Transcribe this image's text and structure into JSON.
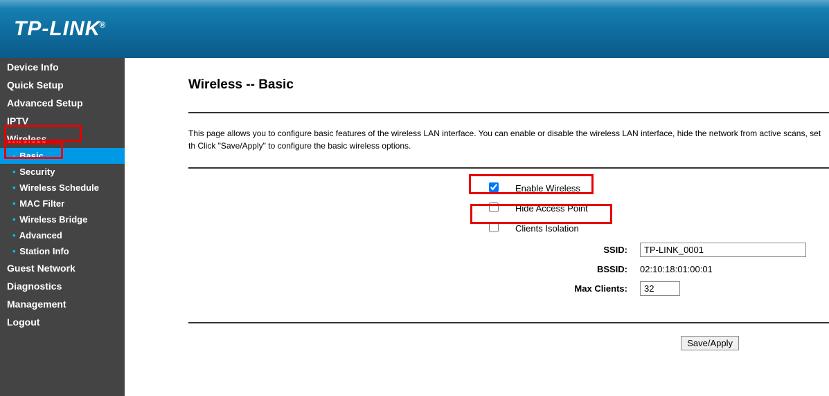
{
  "logo": "TP-LINK®",
  "sidebar": {
    "items": [
      {
        "label": "Device Info"
      },
      {
        "label": "Quick Setup"
      },
      {
        "label": "Advanced Setup"
      },
      {
        "label": "IPTV"
      },
      {
        "label": "Wireless"
      },
      {
        "label": "Guest Network"
      },
      {
        "label": "Diagnostics"
      },
      {
        "label": "Management"
      },
      {
        "label": "Logout"
      }
    ],
    "wireless_sub": [
      {
        "label": "Basic"
      },
      {
        "label": "Security"
      },
      {
        "label": "Wireless Schedule"
      },
      {
        "label": "MAC Filter"
      },
      {
        "label": "Wireless Bridge"
      },
      {
        "label": "Advanced"
      },
      {
        "label": "Station Info"
      }
    ]
  },
  "main": {
    "title": "Wireless -- Basic",
    "description": "This page allows you to configure basic features of the wireless LAN interface. You can enable or disable the wireless LAN interface, hide the network from active scans, set th Click \"Save/Apply\" to configure the basic wireless options.",
    "enable_wireless_label": "Enable Wireless",
    "hide_ap_label": "Hide Access Point",
    "clients_isolation_label": "Clients Isolation",
    "ssid_label": "SSID:",
    "ssid_value": "TP-LINK_0001",
    "bssid_label": "BSSID:",
    "bssid_value": "02:10:18:01:00:01",
    "max_clients_label": "Max Clients:",
    "max_clients_value": "32",
    "save_button": "Save/Apply"
  }
}
